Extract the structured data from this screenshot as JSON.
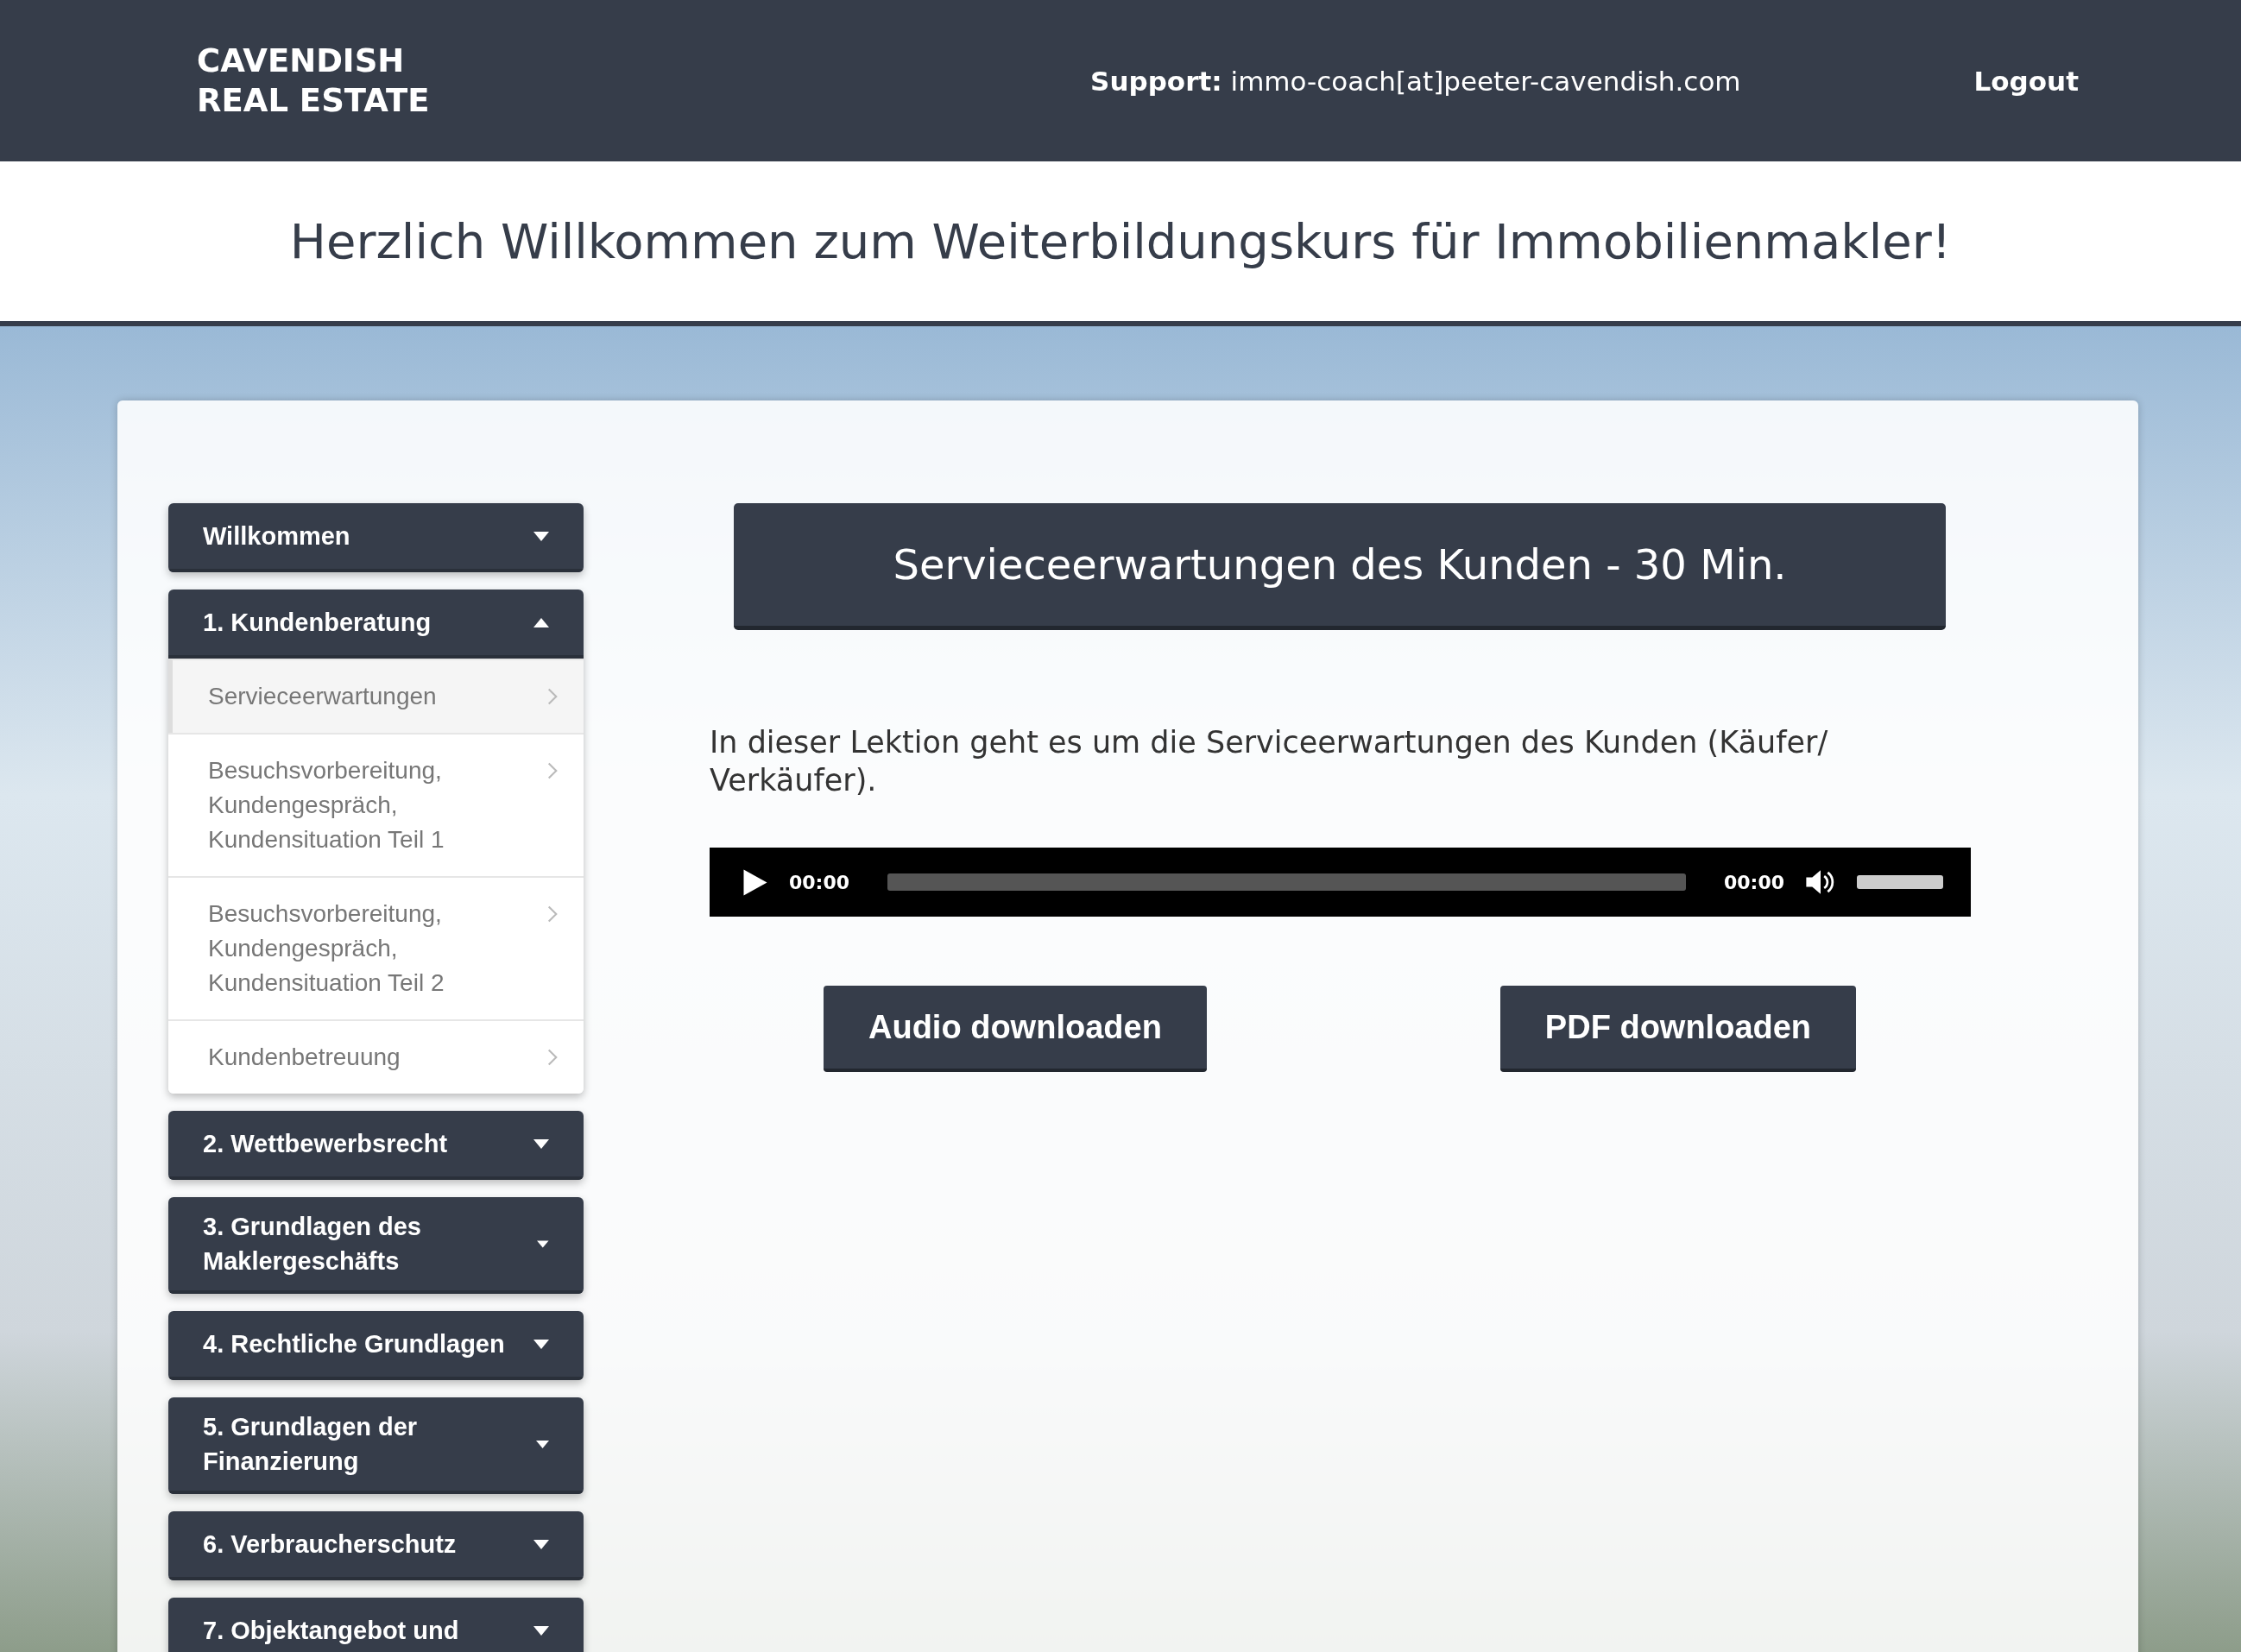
{
  "header": {
    "logo": [
      "CAVENDISH",
      "REAL ESTATE"
    ],
    "support": "**Support:** immo-coach[at]peeter-cavendish.com",
    "logout": "Logout"
  },
  "page_title": "Herzlich Willkommen zum Weiterbildungskurs für Immobilienmakler!",
  "sidebar": {
    "sections": [
      {
        "title": "Willkommen",
        "expanded": false
      },
      {
        "title": "1. Kundenberatung",
        "expanded": true,
        "children": [
          {
            "label": "Servieceerwartungen",
            "selected": true
          },
          {
            "label": "Besuchsvorbereitung, Kundengespräch, Kundensituation Teil 1",
            "selected": false
          },
          {
            "label": "Besuchsvorbereitung, Kundengespräch, Kundensituation Teil 2",
            "selected": false
          },
          {
            "label": "Kundenbetreuung",
            "selected": false
          }
        ]
      },
      {
        "title": "2. Wettbewerbsrecht",
        "expanded": false
      },
      {
        "title": "3. Grundlagen des Maklergeschäfts",
        "expanded": false
      },
      {
        "title": "4. Rechtliche Grundlagen",
        "expanded": false
      },
      {
        "title": "5. Grundlagen der Finanzierung",
        "expanded": false
      },
      {
        "title": "6. Verbraucherschutz",
        "expanded": false
      },
      {
        "title": "7. Objektangebot und",
        "expanded": false
      }
    ]
  },
  "lesson": {
    "title": "Servieceerwartungen des Kunden - 30 Min.",
    "description": "In dieser Lektion geht es um die Serviceerwartungen des Kunden (Käufer/ Verkäufer).",
    "player": {
      "current": "00:00",
      "duration": "00:00",
      "level": 0,
      "volume": {
        "level": 1
      }
    },
    "buttons": [
      "Audio downloaden",
      "PDF downloaden"
    ]
  }
}
